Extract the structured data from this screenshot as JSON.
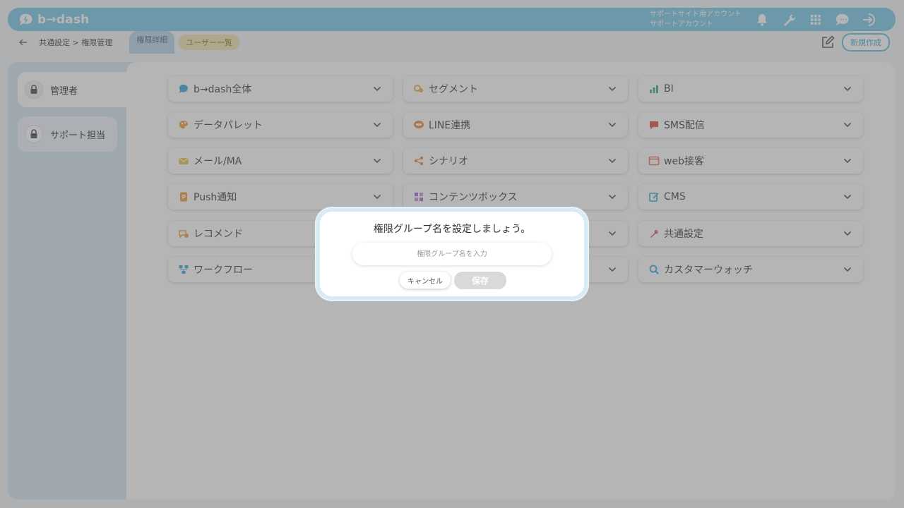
{
  "app": {
    "logo_text": "b→dash"
  },
  "header": {
    "account_line1": "サポートサイト用アカウント",
    "account_line2": "サポートアカウント",
    "icons": [
      "bell-icon",
      "wrench-icon",
      "grid-icon",
      "chat-icon",
      "logout-icon"
    ]
  },
  "subbar": {
    "breadcrumb": "共通設定 > 権限管理",
    "tab_detail": "権限詳細",
    "tab_users": "ユーザー一覧",
    "new_button": "新規作成"
  },
  "sidebar": {
    "items": [
      {
        "label": "管理者",
        "active": true
      },
      {
        "label": "サポート担当",
        "active": false
      }
    ]
  },
  "features": {
    "cards": [
      {
        "label": "b→dash全体",
        "icon": "bdash-icon",
        "color": "#3fa9d8"
      },
      {
        "label": "セグメント",
        "icon": "segment-icon",
        "color": "#e8b24c"
      },
      {
        "label": "BI",
        "icon": "bi-chart-icon",
        "color": "#4cae7a"
      },
      {
        "label": "データパレット",
        "icon": "data-palette-icon",
        "color": "#f0a03c"
      },
      {
        "label": "LINE連携",
        "icon": "line-icon",
        "color": "#f08a3c"
      },
      {
        "label": "SMS配信",
        "icon": "sms-icon",
        "color": "#e0524c"
      },
      {
        "label": "メール/MA",
        "icon": "mail-icon",
        "color": "#e9c34a"
      },
      {
        "label": "シナリオ",
        "icon": "scenario-icon",
        "color": "#f08a3c"
      },
      {
        "label": "web接客",
        "icon": "web-icon",
        "color": "#e87a6a"
      },
      {
        "label": "Push通知",
        "icon": "push-icon",
        "color": "#f0a03c"
      },
      {
        "label": "コンテンツボックス",
        "icon": "content-box-icon",
        "color": "#b46ad0"
      },
      {
        "label": "CMS",
        "icon": "cms-icon",
        "color": "#3fa9d8"
      },
      {
        "label": "レコメンド",
        "icon": "recommend-icon",
        "color": "#f0a03c"
      },
      {
        "label": "",
        "icon": "",
        "color": "#999999"
      },
      {
        "label": "共通設定",
        "icon": "common-settings-icon",
        "color": "#e0524c"
      },
      {
        "label": "ワークフロー",
        "icon": "workflow-icon",
        "color": "#3fa9d8"
      },
      {
        "label": "",
        "icon": "",
        "color": "#999999"
      },
      {
        "label": "カスタマーウォッチ",
        "icon": "customer-watch-icon",
        "color": "#3fa9d8"
      }
    ]
  },
  "modal": {
    "title": "権限グループ名を設定しましょう。",
    "input_placeholder": "権限グループ名を入力",
    "input_value": "",
    "cancel_label": "キャンセル",
    "save_label": "保存"
  },
  "colors": {
    "accent": "#7ccbea",
    "sidebar_bg": "#d8e8f5",
    "tab_detail_bg": "#b9d6ec",
    "tab_users_bg": "#f5e6b2"
  }
}
